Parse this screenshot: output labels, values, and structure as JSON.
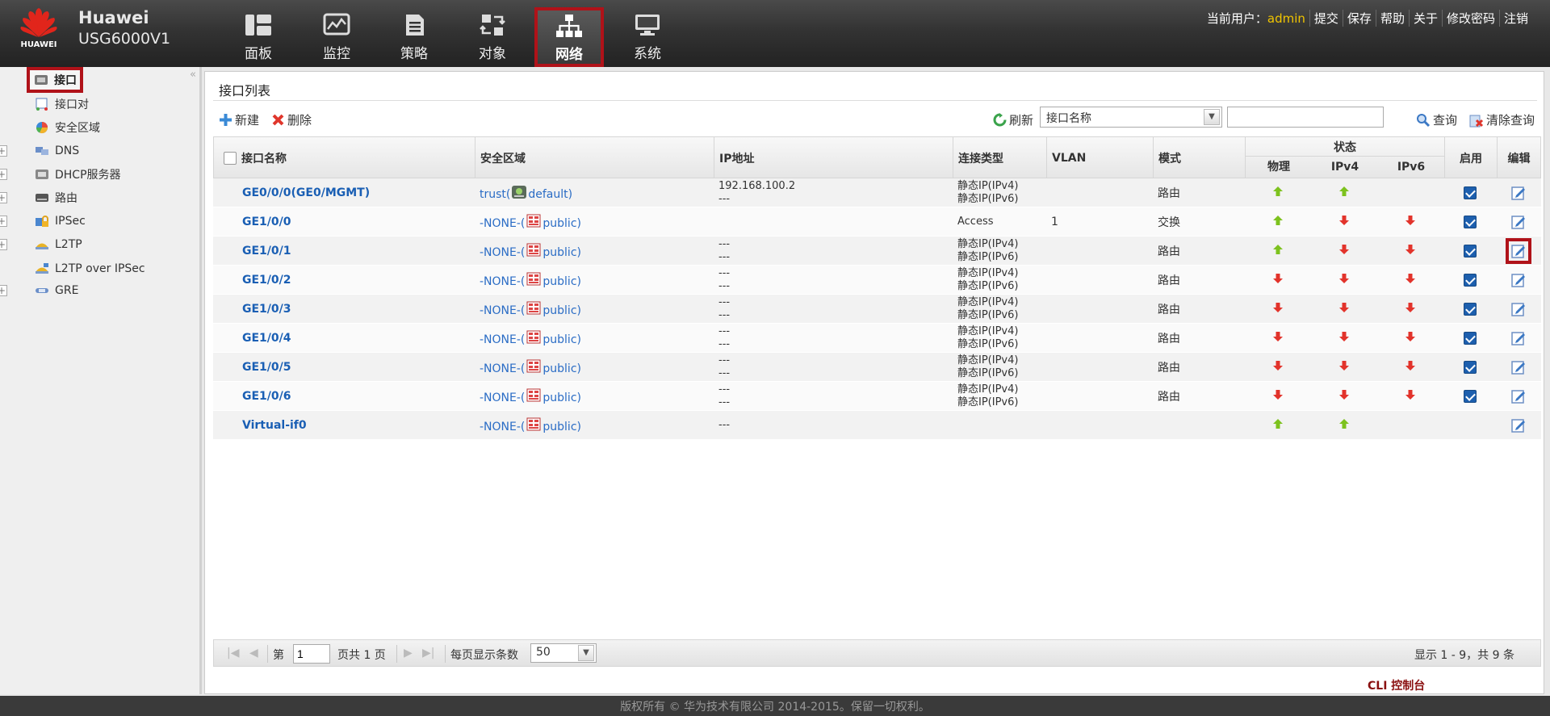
{
  "brand": {
    "logo_text": "HUAWEI",
    "name": "Huawei",
    "model": "USG6000V1"
  },
  "nav": [
    {
      "label": "面板",
      "icon": "dashboard-icon"
    },
    {
      "label": "监控",
      "icon": "monitor-icon"
    },
    {
      "label": "策略",
      "icon": "policy-icon"
    },
    {
      "label": "对象",
      "icon": "object-icon"
    },
    {
      "label": "网络",
      "icon": "network-icon",
      "active": true
    },
    {
      "label": "系统",
      "icon": "system-icon"
    }
  ],
  "user_bar": {
    "current_user_label": "当前用户：",
    "user_name": "admin",
    "links": [
      "提交",
      "保存",
      "帮助",
      "关于",
      "修改密码",
      "注销"
    ]
  },
  "sidebar": {
    "collapse": "«",
    "items": [
      {
        "label": "接口",
        "selected": true,
        "expandable": false,
        "icon": "interface-icon"
      },
      {
        "label": "接口对",
        "expandable": false,
        "icon": "interface-pair-icon"
      },
      {
        "label": "安全区域",
        "expandable": false,
        "icon": "security-zone-icon"
      },
      {
        "label": "DNS",
        "expandable": true,
        "icon": "dns-icon"
      },
      {
        "label": "DHCP服务器",
        "expandable": true,
        "icon": "dhcp-icon"
      },
      {
        "label": "路由",
        "expandable": true,
        "icon": "route-icon"
      },
      {
        "label": "IPSec",
        "expandable": true,
        "icon": "ipsec-icon"
      },
      {
        "label": "L2TP",
        "expandable": true,
        "icon": "l2tp-icon"
      },
      {
        "label": "L2TP over IPSec",
        "expandable": false,
        "icon": "l2tp-ipsec-icon"
      },
      {
        "label": "GRE",
        "expandable": true,
        "icon": "gre-icon"
      }
    ]
  },
  "panel": {
    "title": "接口列表",
    "toolbar": {
      "new_label": "新建",
      "delete_label": "删除",
      "refresh_label": "刷新",
      "query_label": "查询",
      "clear_query_label": "清除查询"
    },
    "filter": {
      "selected": "接口名称",
      "search_value": ""
    }
  },
  "table": {
    "columns": {
      "name": "接口名称",
      "zone": "安全区域",
      "ip": "IP地址",
      "conn_type": "连接类型",
      "vlan": "VLAN",
      "mode": "模式",
      "status": "状态",
      "physical": "物理",
      "ipv4": "IPv4",
      "ipv6": "IPv6",
      "enable": "启用",
      "edit": "编辑"
    },
    "rows": [
      {
        "name": "GE0/0/0(GE0/MGMT)",
        "zone_prefix": "trust(",
        "zone_vsys": "default)",
        "zone_icon": "vsys-root-icon",
        "ip1": "192.168.100.2",
        "ip2": "---",
        "conn1": "静态IP(IPv4)",
        "conn2": "静态IP(IPv6)",
        "vlan": "",
        "mode": "路由",
        "phys": "up",
        "v4": "up",
        "v6": "",
        "enabled": true
      },
      {
        "name": "GE1/0/0",
        "zone_prefix": "-NONE-(",
        "zone_vsys": "public)",
        "zone_icon": "vsys-public-icon",
        "ip1": "",
        "ip2": "",
        "conn1": "Access",
        "conn2": "",
        "vlan": "1",
        "mode": "交换",
        "phys": "up",
        "v4": "down",
        "v6": "down",
        "enabled": true
      },
      {
        "name": "GE1/0/1",
        "zone_prefix": "-NONE-(",
        "zone_vsys": "public)",
        "zone_icon": "vsys-public-icon",
        "ip1": "---",
        "ip2": "---",
        "conn1": "静态IP(IPv4)",
        "conn2": "静态IP(IPv6)",
        "vlan": "",
        "mode": "路由",
        "phys": "up",
        "v4": "down",
        "v6": "down",
        "enabled": true,
        "edit_highlight": true
      },
      {
        "name": "GE1/0/2",
        "zone_prefix": "-NONE-(",
        "zone_vsys": "public)",
        "zone_icon": "vsys-public-icon",
        "ip1": "---",
        "ip2": "---",
        "conn1": "静态IP(IPv4)",
        "conn2": "静态IP(IPv6)",
        "vlan": "",
        "mode": "路由",
        "phys": "down",
        "v4": "down",
        "v6": "down",
        "enabled": true
      },
      {
        "name": "GE1/0/3",
        "zone_prefix": "-NONE-(",
        "zone_vsys": "public)",
        "zone_icon": "vsys-public-icon",
        "ip1": "---",
        "ip2": "---",
        "conn1": "静态IP(IPv4)",
        "conn2": "静态IP(IPv6)",
        "vlan": "",
        "mode": "路由",
        "phys": "down",
        "v4": "down",
        "v6": "down",
        "enabled": true
      },
      {
        "name": "GE1/0/4",
        "zone_prefix": "-NONE-(",
        "zone_vsys": "public)",
        "zone_icon": "vsys-public-icon",
        "ip1": "---",
        "ip2": "---",
        "conn1": "静态IP(IPv4)",
        "conn2": "静态IP(IPv6)",
        "vlan": "",
        "mode": "路由",
        "phys": "down",
        "v4": "down",
        "v6": "down",
        "enabled": true
      },
      {
        "name": "GE1/0/5",
        "zone_prefix": "-NONE-(",
        "zone_vsys": "public)",
        "zone_icon": "vsys-public-icon",
        "ip1": "---",
        "ip2": "---",
        "conn1": "静态IP(IPv4)",
        "conn2": "静态IP(IPv6)",
        "vlan": "",
        "mode": "路由",
        "phys": "down",
        "v4": "down",
        "v6": "down",
        "enabled": true
      },
      {
        "name": "GE1/0/6",
        "zone_prefix": "-NONE-(",
        "zone_vsys": "public)",
        "zone_icon": "vsys-public-icon",
        "ip1": "---",
        "ip2": "---",
        "conn1": "静态IP(IPv4)",
        "conn2": "静态IP(IPv6)",
        "vlan": "",
        "mode": "路由",
        "phys": "down",
        "v4": "down",
        "v6": "down",
        "enabled": true
      },
      {
        "name": "Virtual-if0",
        "zone_prefix": "-NONE-(",
        "zone_vsys": "public)",
        "zone_icon": "vsys-public-icon",
        "ip1": "---",
        "ip2": "",
        "conn1": "",
        "conn2": "",
        "vlan": "",
        "mode": "",
        "phys": "up",
        "v4": "up",
        "v6": "",
        "enabled": null
      }
    ]
  },
  "pager": {
    "page_prefix": "第",
    "page_value": "1",
    "page_suffix": "页共 1 页",
    "per_page_label": "每页显示条数",
    "per_page_value": "50",
    "summary": "显示 1 - 9，共 9 条"
  },
  "cli_console": "CLI 控制台",
  "footer": "版权所有 © 华为技术有限公司 2014-2015。保留一切权利。",
  "colors": {
    "accent_red": "#b01219",
    "link_blue": "#1a5fb4",
    "status_up": "#7dc21e",
    "status_down": "#e2332b",
    "user_name": "#f0c400"
  }
}
